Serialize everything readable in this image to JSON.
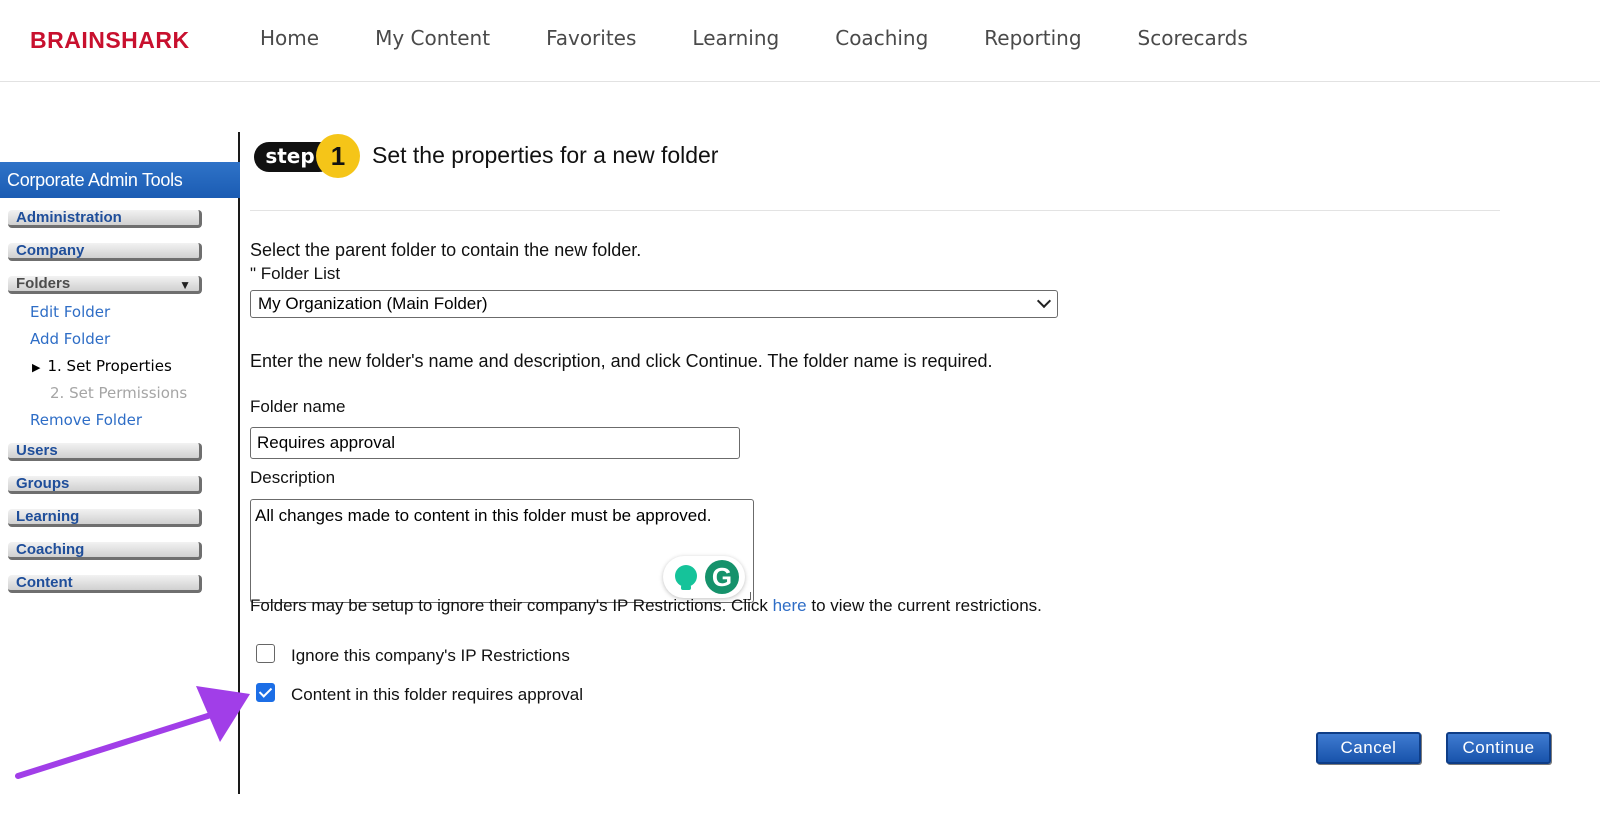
{
  "header": {
    "logo_text": "BRAINSHARK",
    "nav": [
      "Home",
      "My Content",
      "Favorites",
      "Learning",
      "Coaching",
      "Reporting",
      "Scorecards"
    ]
  },
  "sidebar": {
    "title": "Corporate Admin Tools",
    "sections": {
      "administration": "Administration",
      "company": "Company",
      "folders": "Folders",
      "users": "Users",
      "groups": "Groups",
      "learning": "Learning",
      "coaching": "Coaching",
      "content": "Content"
    },
    "folder_items": {
      "edit": "Edit Folder",
      "add": "Add Folder",
      "set_properties": "1. Set Properties",
      "set_permissions": "2. Set Permissions",
      "remove": "Remove Folder"
    }
  },
  "main": {
    "step_word": "step",
    "step_number": "1",
    "title": "Set the properties for a new folder",
    "parent_instruction": "Select the parent folder to contain the new folder.",
    "folder_list_label": "\" Folder List",
    "folder_list_value": "My Organization (Main Folder)",
    "name_instruction": "Enter the new folder's name and description, and click Continue. The folder name is required.",
    "folder_name_label": "Folder name",
    "folder_name_value": "Requires approval",
    "description_label": "Description",
    "description_value": "All changes made to content in this folder must be approved.",
    "ip_text_before": "Folders may be setup to ignore their company's IP Restrictions. Click ",
    "ip_link": "here",
    "ip_text_after": " to view the current restrictions.",
    "checkbox_ignore_ip": "Ignore this company's IP Restrictions",
    "checkbox_requires_approval": "Content in this folder requires approval",
    "ignore_ip_checked": false,
    "requires_approval_checked": true,
    "cancel_label": "Cancel",
    "continue_label": "Continue"
  },
  "colors": {
    "brand_red": "#c8102e",
    "sidebar_blue": "#1b5cb3",
    "link_blue": "#2e6dc6",
    "button_blue": "#1853ab",
    "annotation_purple": "#a13ee8",
    "step_yellow": "#f5c518"
  }
}
